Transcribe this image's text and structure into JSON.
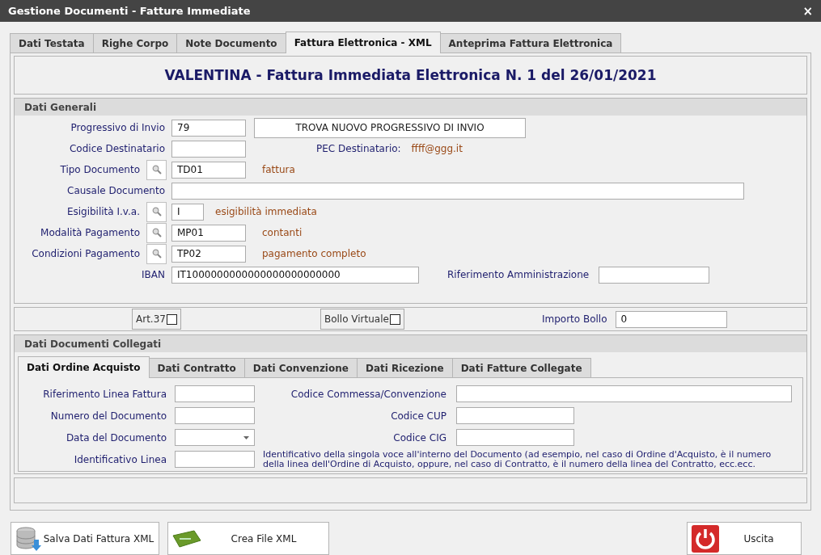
{
  "window": {
    "title": "Gestione Documenti - Fatture Immediate",
    "close": "×"
  },
  "tabs": [
    {
      "label": "Dati Testata",
      "selected": false
    },
    {
      "label": "Righe Corpo",
      "selected": false
    },
    {
      "label": "Note Documento",
      "selected": false
    },
    {
      "label": "Fattura Elettronica - XML",
      "selected": true
    },
    {
      "label": "Anteprima Fattura Elettronica",
      "selected": false
    }
  ],
  "heading": "VALENTINA - Fattura Immediata Elettronica N. 1 del 26/01/2021",
  "dati_generali": {
    "title": "Dati Generali",
    "rows": [
      {
        "label": "Progressivo di Invio",
        "lookup": false,
        "value": "79",
        "action": "TROVA NUOVO PROGRESSIVO DI INVIO"
      },
      {
        "label": "Codice Destinatario",
        "lookup": false,
        "extra_label": "PEC Destinatario:",
        "extra_value": "ffff@ggg.it"
      },
      {
        "label": "Tipo Documento",
        "lookup": true,
        "value": "TD01",
        "description": "fattura"
      },
      {
        "label": "Causale Documento",
        "lookup": false
      },
      {
        "label": "Esigibilità I.v.a.",
        "lookup": true,
        "value": "I",
        "description": "esigibilità immediata"
      },
      {
        "label": "Modalità Pagamento",
        "lookup": true,
        "value": "MP01",
        "description": "contanti"
      },
      {
        "label": "Condizioni Pagamento",
        "lookup": true,
        "value": "TP02",
        "description": "pagamento completo"
      },
      {
        "label": "IBAN",
        "lookup": false,
        "value": "IT1000000000000000000000000",
        "field_label": "Riferimento Amministrazione"
      }
    ]
  },
  "options_bar": [
    {
      "kind": "checkbox",
      "label": "Art.37",
      "checked": false
    },
    {
      "kind": "checkbox",
      "label": "Bollo Virtuale",
      "checked": false
    },
    {
      "kind": "field",
      "label": "Importo Bollo",
      "value": "0"
    }
  ],
  "documenti_collegati": {
    "title": "Dati Documenti Collegati",
    "tabs": [
      {
        "label": "Dati Ordine Acquisto",
        "selected": true
      },
      {
        "label": "Dati Contratto",
        "selected": false
      },
      {
        "label": "Dati Convenzione",
        "selected": false
      },
      {
        "label": "Dati Ricezione",
        "selected": false
      },
      {
        "label": "Dati Fatture Collegate",
        "selected": false
      }
    ],
    "rows": [
      {
        "label": "Riferimento Linea Fattura",
        "kind": "text",
        "right": {
          "label": "Codice Commessa/Convenzione",
          "kind": "wide"
        }
      },
      {
        "label": "Numero del Documento",
        "kind": "text",
        "right": {
          "label": "Codice CUP",
          "kind": "text"
        }
      },
      {
        "label": "Data del Documento",
        "kind": "date",
        "right": {
          "label": "Codice CIG",
          "kind": "text"
        }
      },
      {
        "label": "Identificativo Linea",
        "kind": "text",
        "note": "Identificativo della singola voce all'interno del Documento (ad esempio, nel caso di Ordine d'Acquisto, è il numero della linea dell'Ordine di Acquisto, oppure, nel caso di Contratto, è il numero della linea del Contratto, ecc.ecc."
      }
    ]
  },
  "buttons": [
    {
      "kind": "save",
      "label": "Salva Dati Fattura XML"
    },
    {
      "kind": "create",
      "label": "Crea File XML"
    },
    {
      "kind": "exit",
      "label": "Uscita"
    }
  ]
}
